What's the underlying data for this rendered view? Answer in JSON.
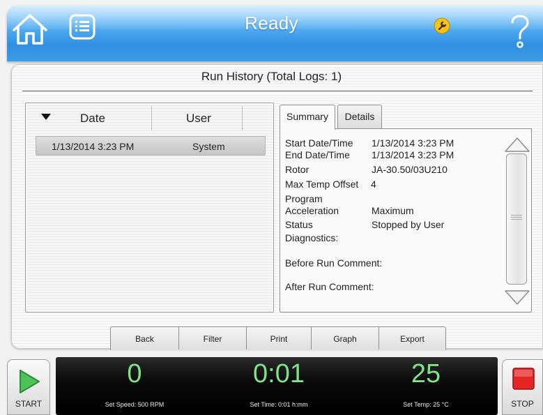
{
  "status": {
    "title": "Ready"
  },
  "icons": {
    "home": "home-icon",
    "menu": "list-menu-icon",
    "service": "wrench-icon",
    "help": "question-mark-icon",
    "start": "play-triangle-icon",
    "stop": "stop-square-icon"
  },
  "colors": {
    "status_bar": "#3c9ae6",
    "readout_text": "#7ee287",
    "start_green": "#3db34a",
    "stop_red": "#e02020"
  },
  "panel": {
    "title": "Run History (Total Logs: 1)"
  },
  "log_list": {
    "columns": [
      "Date",
      "User"
    ],
    "rows": [
      {
        "date": "1/13/2014 3:23 PM",
        "user": "System"
      }
    ]
  },
  "details": {
    "tabs": [
      "Summary",
      "Details"
    ],
    "active_tab": "Summary",
    "fields": [
      {
        "label": "Start Date/Time",
        "value": "1/13/2014 3:23 PM"
      },
      {
        "label": "End Date/Time",
        "value": "1/13/2014 3:23 PM"
      },
      {
        "label": "Rotor",
        "value": "JA-30.50/03U210"
      },
      {
        "label": "Max Temp Offset",
        "value": "4"
      },
      {
        "label": "Program",
        "value": ""
      },
      {
        "label": "Acceleration",
        "value": "Maximum"
      },
      {
        "label": "Status",
        "value": "Stopped by User"
      },
      {
        "label": "Diagnostics:",
        "value": ""
      },
      {
        "label": "Before Run Comment:",
        "value": ""
      },
      {
        "label": "After Run Comment:",
        "value": ""
      }
    ]
  },
  "actions": [
    "Back",
    "Filter",
    "Print",
    "Graph",
    "Export"
  ],
  "footer": {
    "start_label": "START",
    "stop_label": "STOP",
    "speed": {
      "value": "0",
      "label": "Set Speed: 500 RPM"
    },
    "time": {
      "value": "0:01",
      "label": "Set Time: 0:01 h:mm"
    },
    "temp": {
      "value": "25",
      "label": "Set Temp: 25 °C"
    }
  }
}
